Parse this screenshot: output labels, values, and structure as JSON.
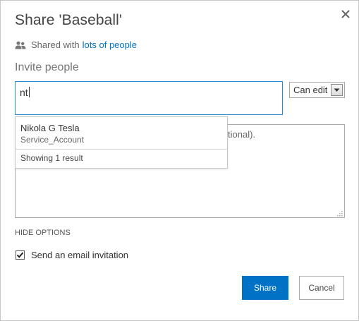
{
  "dialog": {
    "title": "Share 'Baseball'",
    "close_icon": "close-icon"
  },
  "shared": {
    "icon": "people-icon",
    "prefix": "Shared with",
    "link": "lots of people"
  },
  "invite": {
    "label": "Invite people",
    "input_value": "nt",
    "permission": "Can edit",
    "permission_arrow_icon": "chevron-down-icon"
  },
  "suggestions": {
    "items": [
      {
        "name": "Nikola G Tesla",
        "account": "Service_Account"
      }
    ],
    "footer": "Showing 1 result"
  },
  "message": {
    "visible_placeholder_fragment": "tional)."
  },
  "options": {
    "hide_label": "HIDE OPTIONS",
    "email_checkbox_label": "Send an email invitation",
    "email_checked": true
  },
  "buttons": {
    "share": "Share",
    "cancel": "Cancel"
  },
  "colors": {
    "accent": "#0072c6",
    "input_focus_border": "#2a8dd4"
  }
}
